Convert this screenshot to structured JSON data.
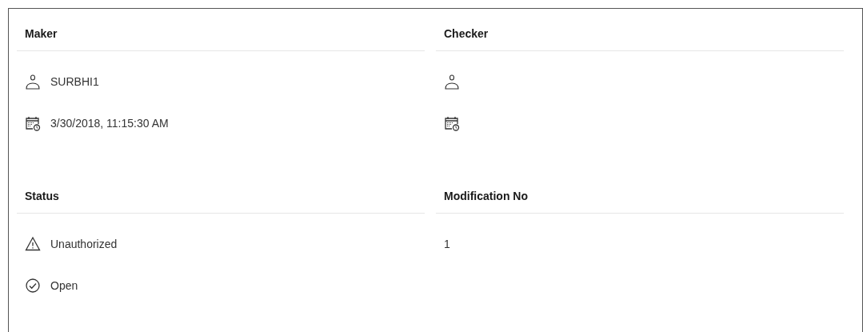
{
  "sections": [
    {
      "title": "Maker",
      "items": [
        {
          "kind": "user",
          "text": "SURBHI1"
        },
        {
          "kind": "datetime",
          "text": "3/30/2018, 11:15:30 AM"
        }
      ]
    },
    {
      "title": "Checker",
      "items": [
        {
          "kind": "user"
        },
        {
          "kind": "datetime"
        }
      ]
    },
    {
      "title": "Status",
      "items": [
        {
          "kind": "warning",
          "text": "Unauthorized"
        },
        {
          "kind": "check",
          "text": "Open"
        }
      ]
    },
    {
      "title": "Modification No",
      "items": [
        {
          "kind": "plain",
          "text": "1"
        }
      ]
    }
  ]
}
